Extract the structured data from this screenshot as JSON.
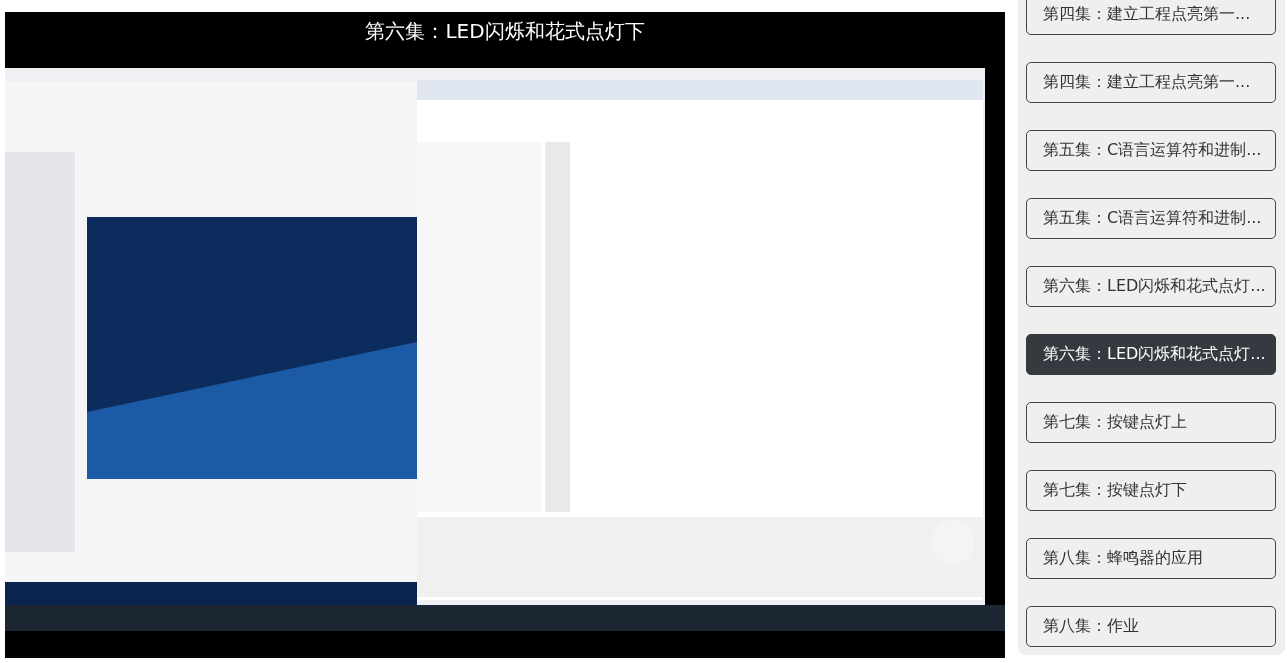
{
  "video": {
    "kind": "picture",
    "title": "第六集：LED闪烁和花式点灯下"
  },
  "playlist": {
    "items": [
      {
        "label": "第四集：建立工程点亮第一...",
        "selected": false
      },
      {
        "label": "第四集：建立工程点亮第一...",
        "selected": false
      },
      {
        "label": "第五集：C语言运算符和进制...",
        "selected": false
      },
      {
        "label": "第五集：C语言运算符和进制...",
        "selected": false
      },
      {
        "label": "第六集：LED闪烁和花式点灯...",
        "selected": false
      },
      {
        "label": "第六集：LED闪烁和花式点灯...",
        "selected": true
      },
      {
        "label": "第七集：按键点灯上",
        "selected": false
      },
      {
        "label": "第七集：按键点灯下",
        "selected": false
      },
      {
        "label": "第八集：蜂鸣器的应用",
        "selected": false
      },
      {
        "label": "第八集：作业",
        "selected": false
      }
    ]
  }
}
